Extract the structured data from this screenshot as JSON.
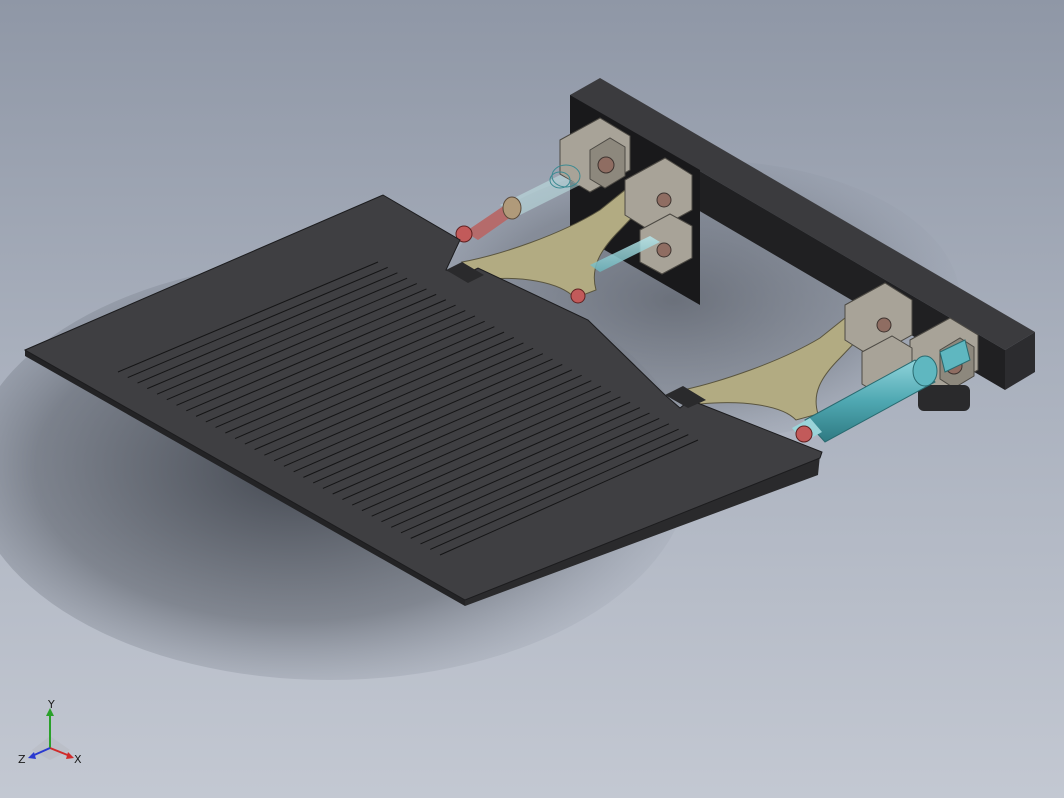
{
  "viewport": {
    "background_top": "#8f97a6",
    "background_bottom": "#c3c8d2"
  },
  "model": {
    "plate_color": "#3a3a3c",
    "bracket_color": "#b2ab82",
    "clevis_color": "#a8a398",
    "cylinder_color": "#5fb7c0",
    "pin_color": "#c25a5a",
    "beam_color": "#262628"
  },
  "triad": {
    "x_label": "X",
    "y_label": "Y",
    "z_label": "Z",
    "x_color": "#d02a2a",
    "y_color": "#2aa02a",
    "z_color": "#2a3ad0"
  }
}
